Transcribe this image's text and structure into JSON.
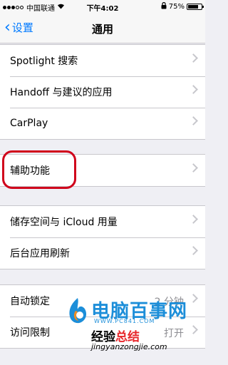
{
  "status_bar": {
    "carrier": "中国联通",
    "wifi_icon": "wifi-icon",
    "time": "下午4:02",
    "lock_icon": "lock-icon",
    "battery_percent_text": "75%",
    "battery_level": 0.75
  },
  "nav": {
    "back_label": "设置",
    "title": "通用",
    "accent_color": "#007aff"
  },
  "groups": [
    {
      "rows": [
        {
          "label": "Spotlight 搜索"
        },
        {
          "label": "Handoff 与建议的应用"
        },
        {
          "label": "CarPlay"
        }
      ]
    },
    {
      "rows": [
        {
          "label": "辅助功能"
        }
      ]
    },
    {
      "rows": [
        {
          "label": "储存空间与 iCloud 用量"
        },
        {
          "label": "后台应用刷新"
        }
      ]
    },
    {
      "rows": [
        {
          "label": "自动锁定",
          "value": "2 分钟"
        },
        {
          "label": "访问限制",
          "value": "打开"
        }
      ]
    }
  ],
  "watermark": {
    "title": "电脑百事网",
    "url": "WWW.PC841.COM",
    "brand_main": "经验",
    "brand_accent": "总结",
    "domain": "jingyanzongjie.com",
    "brand_color": "#1c8ed9",
    "accent_color": "#e7262a"
  }
}
